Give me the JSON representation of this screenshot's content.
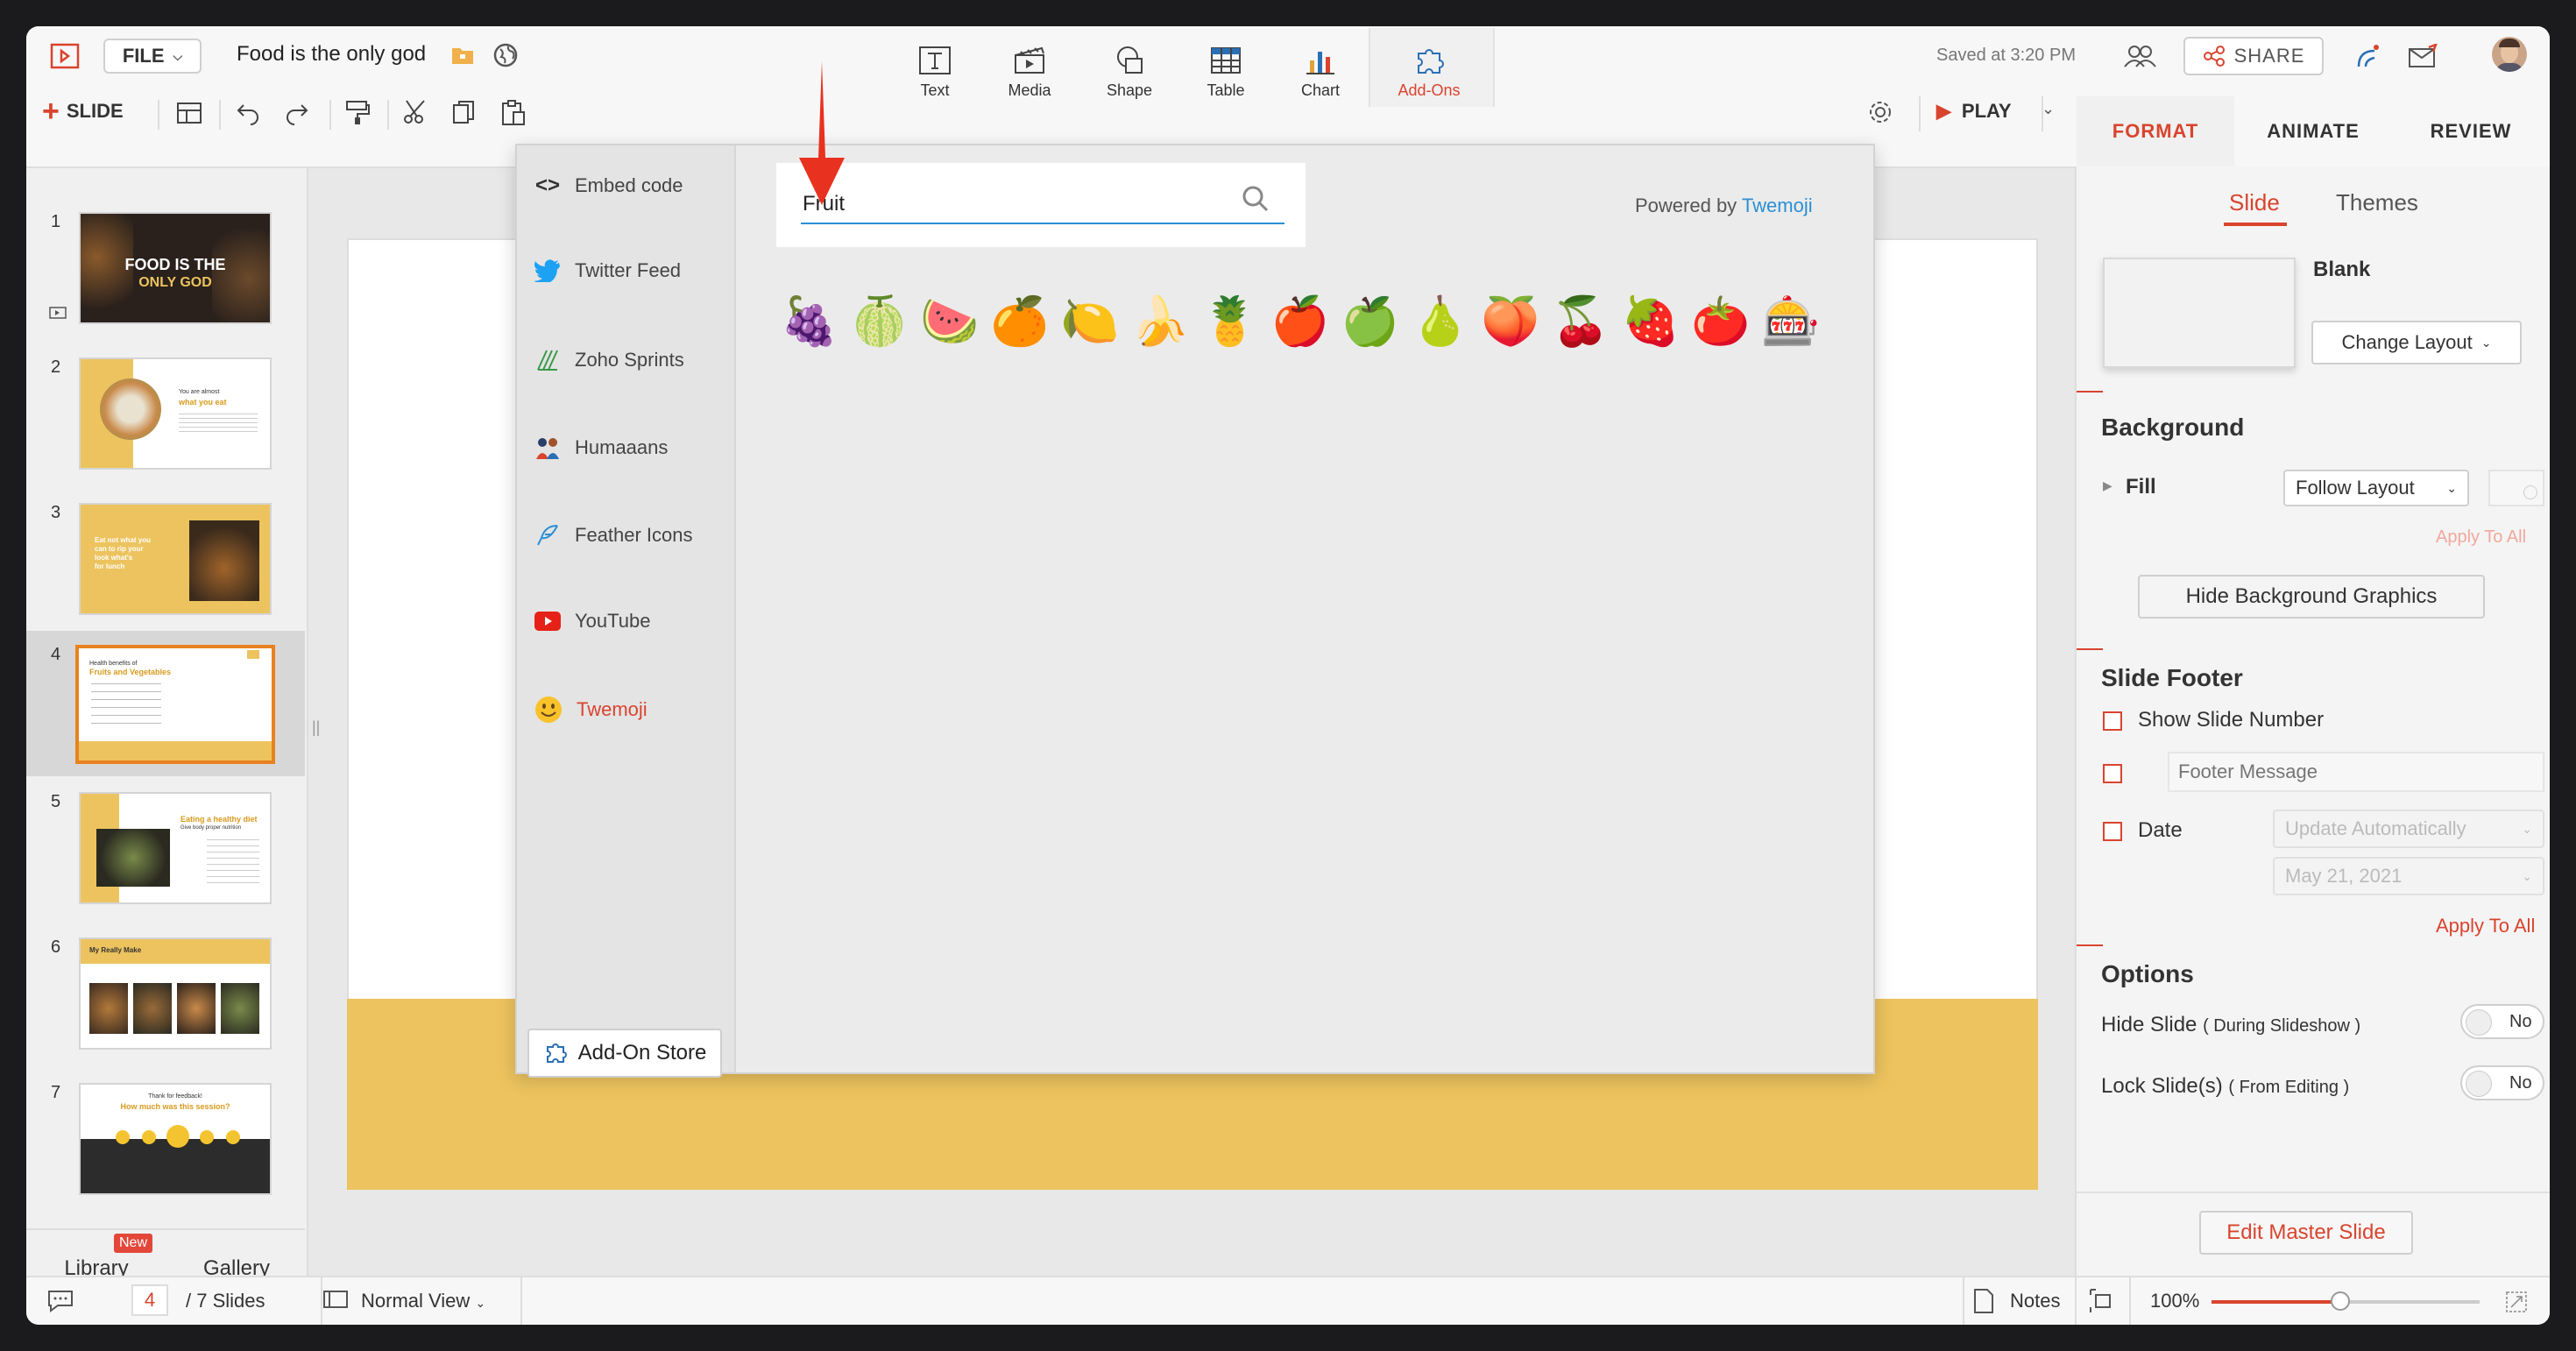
{
  "app": {
    "file_label": "FILE",
    "doc_title": "Food is the only god",
    "saved_status": "Saved at 3:20 PM",
    "share_label": "SHARE"
  },
  "toolbar": {
    "slide_label": "SLIDE",
    "play_label": "PLAY",
    "insert_tools": [
      {
        "label": "Text",
        "icon": "text-icon"
      },
      {
        "label": "Media",
        "icon": "media-icon"
      },
      {
        "label": "Shape",
        "icon": "shape-icon"
      },
      {
        "label": "Table",
        "icon": "table-icon"
      },
      {
        "label": "Chart",
        "icon": "chart-icon"
      },
      {
        "label": "Add-Ons",
        "icon": "puzzle-icon"
      }
    ]
  },
  "right_tabs": [
    "FORMAT",
    "ANIMATE",
    "REVIEW"
  ],
  "slides": {
    "numbers": [
      "1",
      "2",
      "3",
      "4",
      "5",
      "6",
      "7"
    ],
    "thumb_texts": {
      "s1_title": "FOOD IS THE",
      "s1_title2": "ONLY GOD",
      "s2_t1": "You are almost",
      "s2_t2": "what you eat",
      "s3_t1": "Eat not what you",
      "s3_t2": "can to rip your",
      "s3_t3": "look what's",
      "s3_t4": "for lunch",
      "s4_t1": "Health benefits of",
      "s4_t2": "Fruits and Vegetables",
      "s5_t1": "Eating a healthy diet",
      "s5_t2": "Give body proper nutrition",
      "s6_t1": "My Really Make",
      "s7_t1": "Thank for feedback!",
      "s7_t2": "How much was this session?"
    },
    "selected_index": 4
  },
  "left_tabs": {
    "library": "Library",
    "new_badge": "New",
    "gallery": "Gallery"
  },
  "addon_popup": {
    "items": [
      {
        "label": "Embed code",
        "icon": "code-icon"
      },
      {
        "label": "Twitter Feed",
        "icon": "twitter-icon"
      },
      {
        "label": "Zoho Sprints",
        "icon": "sprints-icon"
      },
      {
        "label": "Humaaans",
        "icon": "humaaans-icon"
      },
      {
        "label": "Feather Icons",
        "icon": "feather-icon"
      },
      {
        "label": "YouTube",
        "icon": "youtube-icon"
      },
      {
        "label": "Twemoji",
        "icon": "smiley-icon"
      }
    ],
    "active_item": "Twemoji",
    "store_label": "Add-On Store",
    "search_value": "Fruit",
    "powered_prefix": "Powered by",
    "powered_link": "Twemoji",
    "emoji_results": [
      "🍇",
      "🍈",
      "🍉",
      "🍊",
      "🍋",
      "🍌",
      "🍍",
      "🍎",
      "🍏",
      "🍐",
      "🍑",
      "🍒",
      "🍓",
      "🍅",
      "🎰"
    ]
  },
  "format_panel": {
    "subtabs": [
      "Slide",
      "Themes"
    ],
    "layout_name": "Blank",
    "change_layout": "Change Layout",
    "background_title": "Background",
    "fill_label": "Fill",
    "fill_value": "Follow Layout",
    "apply_to_all_1": "Apply To All",
    "hide_bg_graphics": "Hide Background Graphics",
    "footer_title": "Slide Footer",
    "show_slide_number": "Show Slide Number",
    "footer_message_placeholder": "Footer Message",
    "date_label": "Date",
    "date_mode": "Update Automatically",
    "date_value": "May 21, 2021",
    "apply_to_all_2": "Apply To All",
    "options_title": "Options",
    "hide_slide": "Hide Slide",
    "hide_slide_sub": "( During Slideshow )",
    "lock_slide": "Lock Slide(s)",
    "lock_slide_sub": "( From Editing )",
    "toggle_no": "No",
    "edit_master": "Edit Master Slide"
  },
  "statusbar": {
    "current_slide": "4",
    "total_slides": "/ 7 Slides",
    "view_mode": "Normal View",
    "notes": "Notes",
    "zoom": "100%"
  },
  "colors": {
    "accent": "#d9442e",
    "link": "#2b8fd6",
    "slide_yellow": "#ecc35e"
  }
}
